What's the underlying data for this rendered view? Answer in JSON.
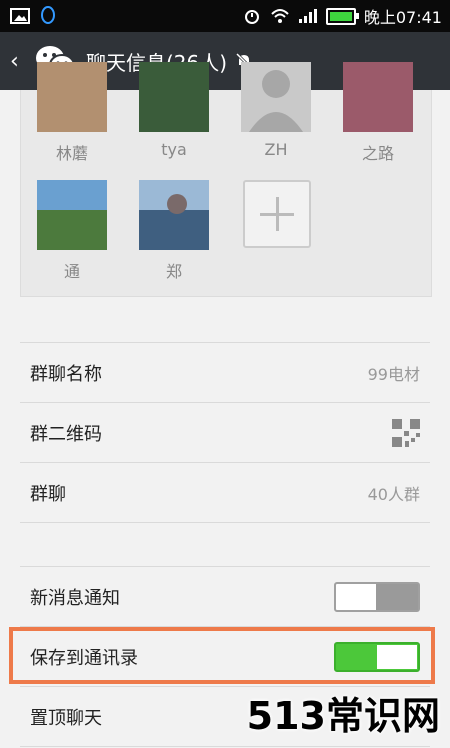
{
  "status_bar": {
    "time": "晚上07:41",
    "icons": [
      "image-icon",
      "qq-icon",
      "alarm-icon",
      "wifi-icon",
      "signal-icon",
      "battery-icon"
    ]
  },
  "header": {
    "title": "聊天信息(26人)",
    "back_icon": "back-arrow-icon",
    "logo_icon": "wechat-logo-icon",
    "mute_icon": "mute-bell-icon"
  },
  "members": [
    {
      "name": "林蘑"
    },
    {
      "name": "tya"
    },
    {
      "name": "ZH"
    },
    {
      "name": "之路"
    },
    {
      "name": "通"
    },
    {
      "name": "郑"
    }
  ],
  "settings": {
    "group_name_label": "群聊名称",
    "group_name_value": "99电材",
    "qr_label": "群二维码",
    "group_label": "群聊",
    "group_value": "40人群",
    "notify_label": "新消息通知",
    "notify_on": false,
    "save_label": "保存到通讯录",
    "save_on": true,
    "top_label": "置顶聊天"
  },
  "colors": {
    "accent_green": "#4cc83a",
    "highlight_orange": "#ee7a4a",
    "header_bg": "#2f3338"
  },
  "watermark": "513常识网"
}
